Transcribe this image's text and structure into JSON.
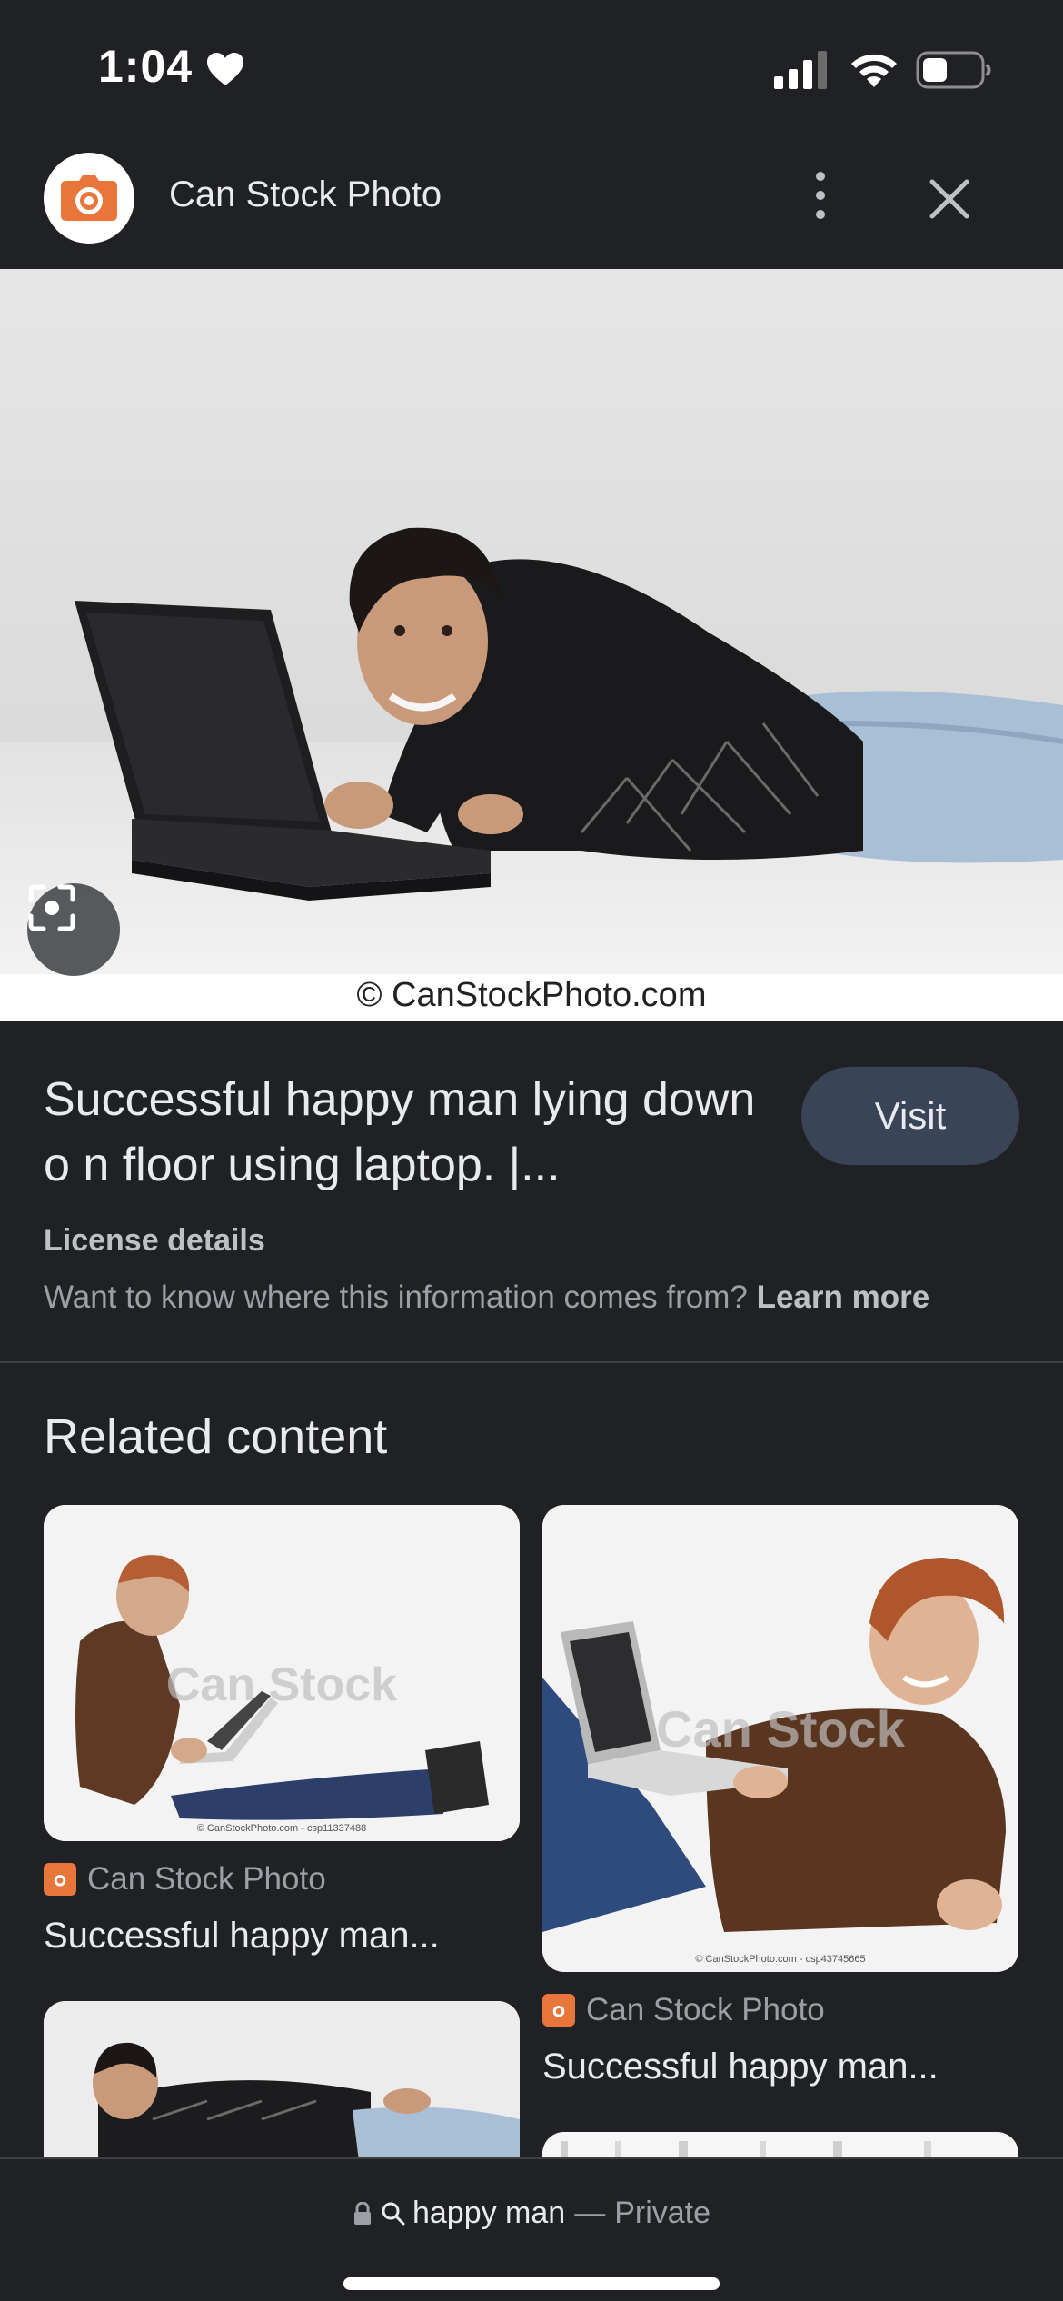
{
  "status_bar": {
    "time": "1:04",
    "icons": [
      "heart-icon",
      "signal-icon",
      "wifi-icon",
      "battery-icon"
    ]
  },
  "header": {
    "site_name": "Can Stock Photo",
    "logo_icon": "camera-icon",
    "menu_icon": "more-vertical-icon",
    "close_icon": "close-icon"
  },
  "image": {
    "watermark": "© CanStockPhoto.com",
    "lens_icon": "lens-icon"
  },
  "result": {
    "title": "Successful happy man lying down o n floor using laptop. |...",
    "visit_label": "Visit",
    "license_label": "License details",
    "info_text": "Want to know where this information comes from?",
    "learn_more": "Learn more"
  },
  "related": {
    "heading": "Related content",
    "cards": [
      {
        "source": "Can Stock Photo",
        "title": "Successful happy man...",
        "watermark": "Can Stock",
        "caption": "© CanStockPhoto.com - csp11337488"
      },
      {
        "source": "Can Stock Photo",
        "title": "Successful happy man...",
        "watermark": "Can Stock",
        "caption": "© CanStockPhoto.com - csp43745665"
      }
    ]
  },
  "bottom_bar": {
    "query": "happy man",
    "separator": "—",
    "mode": "Private"
  },
  "colors": {
    "background": "#202124",
    "brand_orange": "#e8753a",
    "visit_button": "#394457"
  }
}
